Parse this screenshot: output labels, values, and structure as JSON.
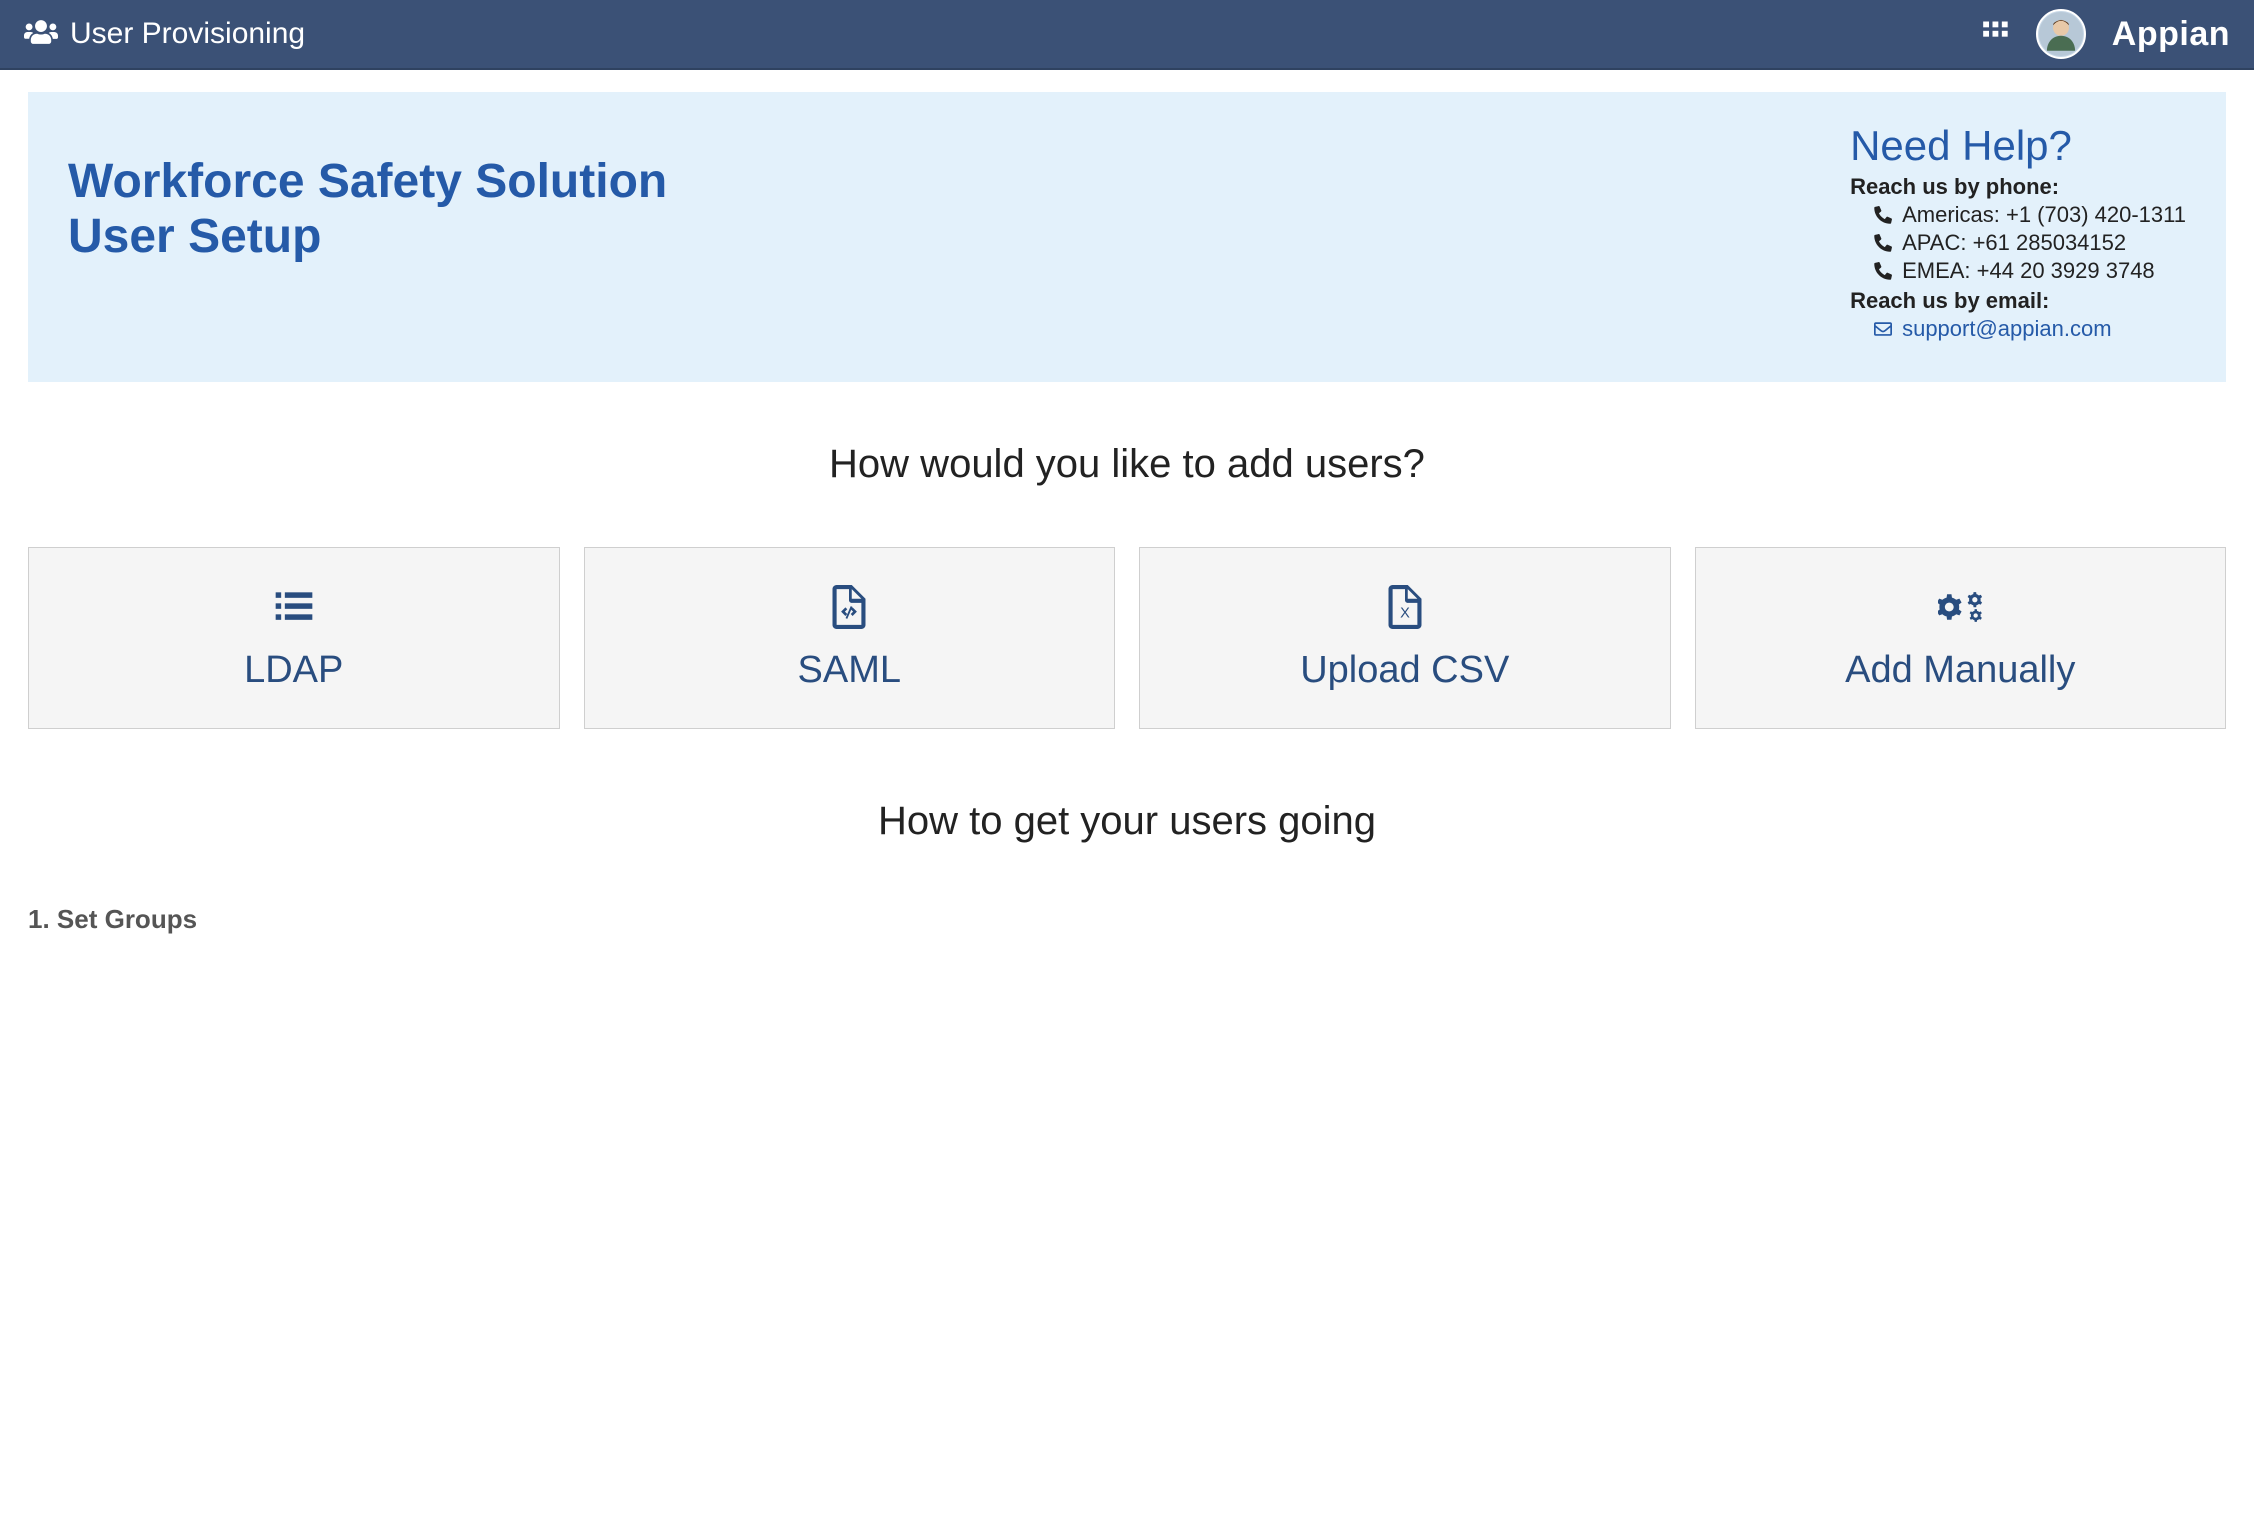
{
  "header": {
    "app_title": "User Provisioning",
    "brand": "Appian"
  },
  "banner": {
    "title_line1": "Workforce Safety Solution",
    "title_line2": "User Setup"
  },
  "help": {
    "title": "Need Help?",
    "phone_label": "Reach us by phone:",
    "phones": {
      "americas": "Americas: +1 (703) 420-1311",
      "apac": "APAC: +61 285034152",
      "emea": "EMEA: +44 20 3929 3748"
    },
    "email_label": "Reach us by email:",
    "email": "support@appian.com"
  },
  "question": "How would you like to add users?",
  "cards": {
    "ldap": "LDAP",
    "saml": "SAML",
    "csv": "Upload CSV",
    "manual": "Add Manually"
  },
  "question2": "How to get your users going",
  "step1": "1. Set Groups"
}
